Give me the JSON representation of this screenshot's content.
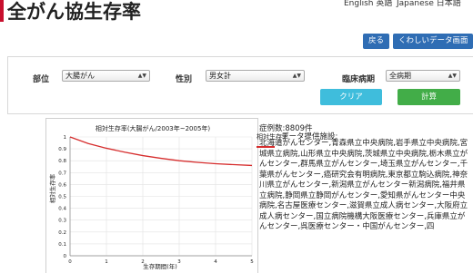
{
  "header": {
    "title": "全がん協生存率",
    "lang_en": "English 英語",
    "lang_ja": "Japanese 日本語"
  },
  "actions": {
    "back_label": "戻る",
    "detail_label": "くわしいデータ画面"
  },
  "form": {
    "site_label": "部位",
    "site_value": "大腸がん",
    "sex_label": "性別",
    "sex_value": "男女計",
    "stage_label": "臨床病期",
    "stage_value": "全病期",
    "clear_label": "クリア",
    "calc_label": "計算"
  },
  "info": {
    "cases_text": "症例数:8809件",
    "provider_text": "データ提供施設:",
    "hospitals_text": "北海道がんセンター,青森県立中央病院,岩手県立中央病院,宮城県立病院,山形県立中央病院,茨城県立中央病院,栃木県立がんセンター,群馬県立がんセンター,埼玉県立がんセンター,千葉県がんセンター,癌研究会有明病院,東京都立駒込病院,神奈川県立がんセンター,新潟県立がんセンター新潟病院,福井県立病院,静岡県立静岡がんセンター,愛知県がんセンター中央病院,名古屋医療センター,滋賀県立成人病センター,大阪府立成人病センター,国立病院機構大阪医療センター,兵庫県立がんセンター,呉医療センター・中国がんセンター,四"
  },
  "chart_data": {
    "type": "line",
    "title": "相対生存率(大腸がん/2003年~2005年)",
    "xlabel": "生存期間(年)",
    "ylabel": "相対生存率",
    "xlim": [
      0,
      5
    ],
    "ylim": [
      0,
      1
    ],
    "x_ticks": [
      "0",
      "1",
      "2",
      "3",
      "4",
      "5"
    ],
    "y_ticks": [
      "0",
      "0.1",
      "0.2",
      "0.3",
      "0.4",
      "0.5",
      "0.6",
      "0.7",
      "0.8",
      "0.9",
      "1"
    ],
    "grid": true,
    "series": [
      {
        "name": "相対生存率",
        "color": "#d62d2d",
        "x": [
          0,
          0.5,
          1,
          1.5,
          2,
          2.5,
          3,
          3.5,
          4,
          4.5,
          5
        ],
        "y": [
          1.0,
          0.945,
          0.905,
          0.872,
          0.843,
          0.82,
          0.8,
          0.786,
          0.775,
          0.767,
          0.76
        ]
      }
    ]
  }
}
